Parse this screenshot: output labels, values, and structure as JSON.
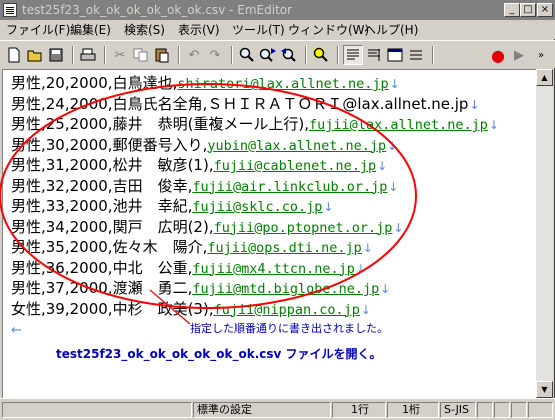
{
  "window": {
    "title": "test25f23_ok_ok_ok_ok_ok_ok.csv - EmEditor"
  },
  "menu": [
    "ファイル(F)",
    "編集(E)",
    "検索(S)",
    "表示(V)",
    "ツール(T)",
    "ウィンドウ(W)",
    "ヘルプ(H)"
  ],
  "toolbar": [
    "new-file",
    "open-file",
    "save",
    "print",
    "cut",
    "copy",
    "paste",
    "undo",
    "redo",
    "find",
    "find-next",
    "find-previous",
    "highlight",
    "word-wrap",
    "wrap-window",
    "show-marks",
    "macro-record",
    "macro-run"
  ],
  "editor": {
    "lines": [
      {
        "text": "男性,20,2000,白鳥達也,",
        "mail": "shiratori@lax.allnet.ne.jp"
      },
      {
        "text": "男性,24,2000,白鳥氏名全角,ＳＨＩＲＡＴＯＲＩ@lax.allnet.ne.jp",
        "mail": ""
      },
      {
        "text": "男性,25,2000,藤井　恭明(重複メール上行),",
        "mail": "fujii@lax.allnet.ne.jp"
      },
      {
        "text": "男性,30,2000,郵便番号入り,",
        "mail": "yubin@lax.allnet.ne.jp"
      },
      {
        "text": "男性,31,2000,松井　敏彦(1),",
        "mail": "fujii@cablenet.ne.jp"
      },
      {
        "text": "男性,32,2000,吉田　俊幸,",
        "mail": "fujii@air.linkclub.or.jp"
      },
      {
        "text": "男性,33,2000,池井　幸紀,",
        "mail": "fujii@sklc.co.jp"
      },
      {
        "text": "男性,34,2000,関戸　広明(2),",
        "mail": "fujii@po.ptopnet.or.jp"
      },
      {
        "text": "男性,35,2000,佐々木　陽介,",
        "mail": "fujii@ops.dti.ne.jp"
      },
      {
        "text": "男性,36,2000,中北　公重,",
        "mail": "fujii@mx4.ttcn.ne.jp"
      },
      {
        "text": "男性,37,2000,渡瀬　勇二,",
        "mail": "fujii@mtd.biglobe.ne.jp"
      },
      {
        "text": "女性,39,2000,中杉　政美(3),",
        "mail": "fujii@nippan.co.jp"
      }
    ],
    "eol_mark": "↓",
    "eof_mark": "←"
  },
  "annotations": {
    "red_note": "指定した順番通りに書き出されました。",
    "blue_note": "test25f23_ok_ok_ok_ok_ok_ok.csv ファイルを開く。"
  },
  "status": {
    "mode": "標準の設定",
    "line": "1行",
    "column": "1桁",
    "encoding": "S-JIS"
  },
  "colors": {
    "ellipse": "#ff0000",
    "url": "#007f00",
    "note": "#0000c0"
  }
}
